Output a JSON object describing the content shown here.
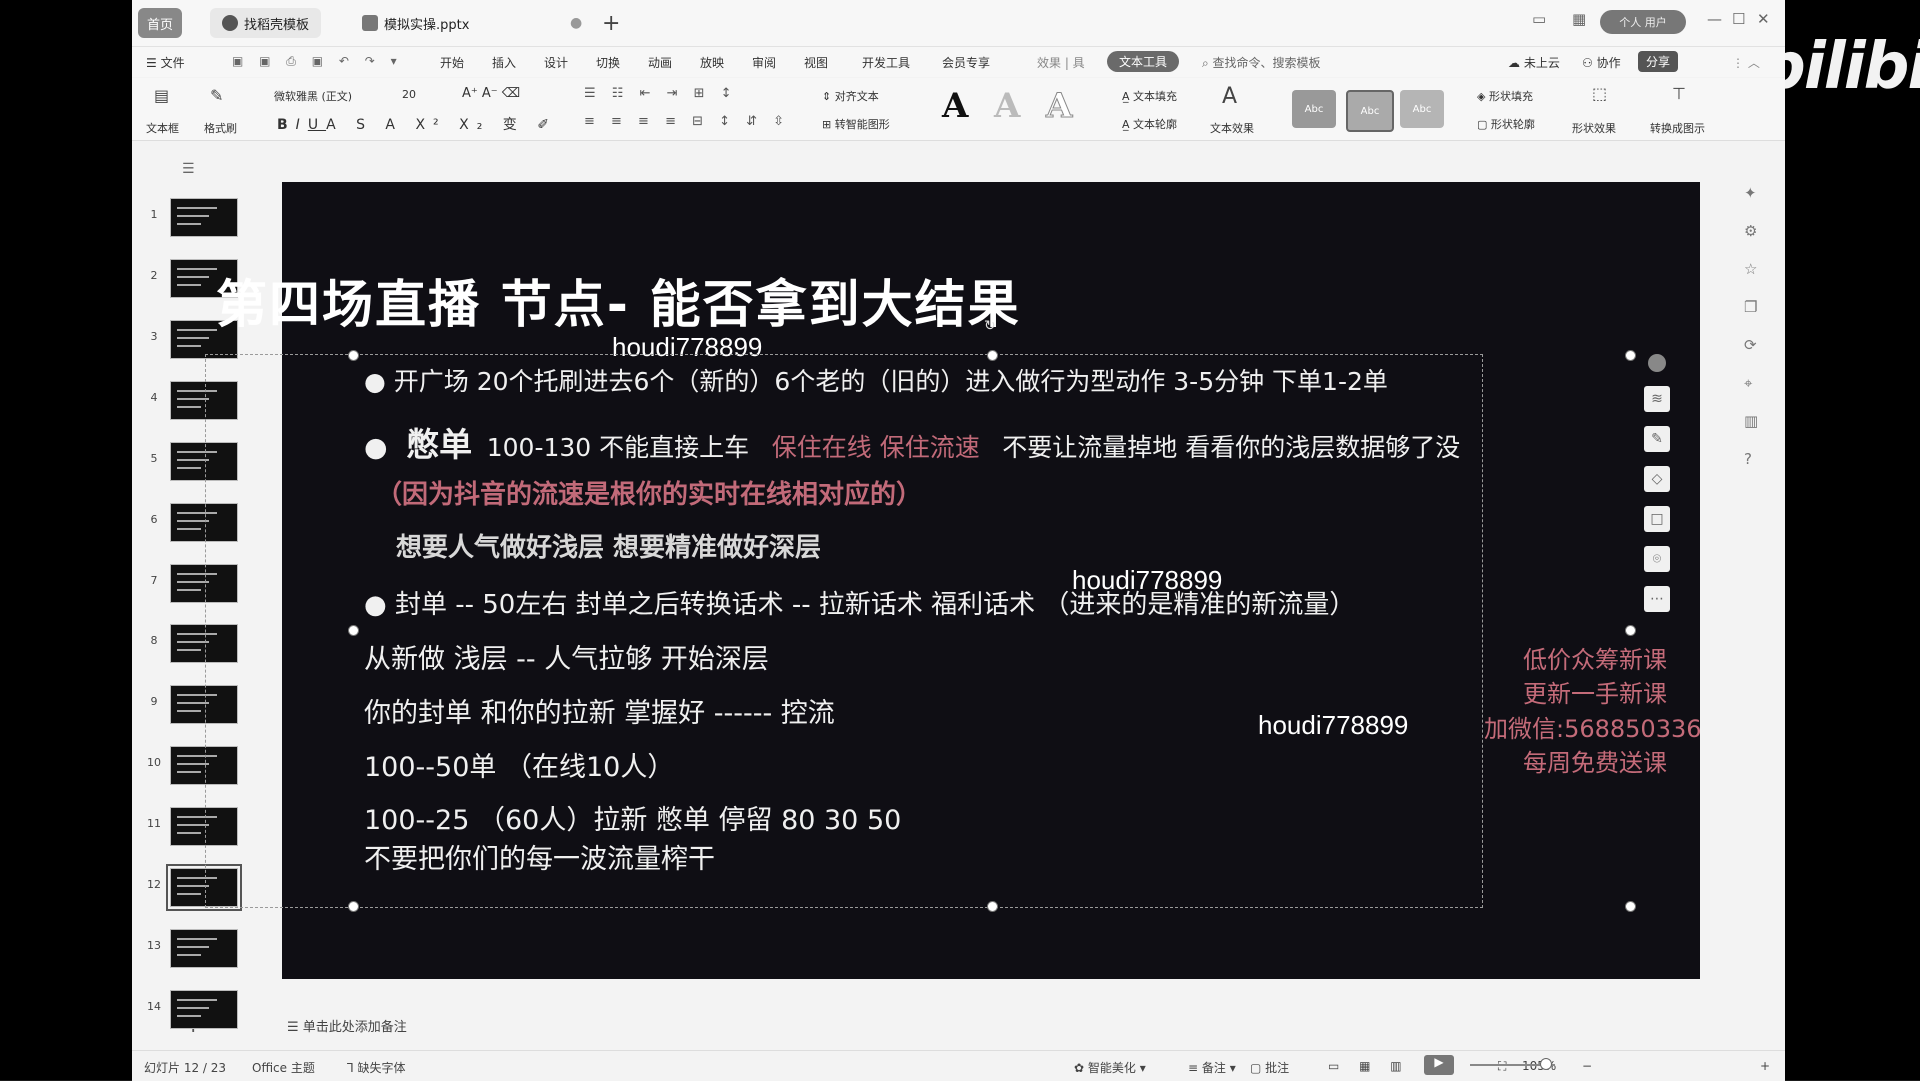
{
  "watermark_brand": "bilibili",
  "window": {
    "tabs": [
      {
        "label": "首页"
      },
      {
        "label": "找稻壳模板"
      },
      {
        "label": "模拟实操.pptx"
      }
    ],
    "user_name": "个人 用户"
  },
  "menu": {
    "file": "文件",
    "items": [
      "开始",
      "插入",
      "设计",
      "切换",
      "动画",
      "放映",
      "审阅",
      "视图",
      "开发工具",
      "会员专享"
    ],
    "extra": "效果 | 具",
    "active": "文本工具",
    "search": "查找命令、搜索模板",
    "cloud": "未上云",
    "share": "协作",
    "share_btn": "分享"
  },
  "ribbon": {
    "textbox": "文本框",
    "format_painter": "格式刷",
    "font_name": "微软雅黑 (正文)",
    "font_size": "20",
    "align_text": "对齐文本",
    "smart_shape": "转智能图形",
    "text_fill": "文本填充",
    "text_outline": "文本轮廓",
    "text_effect": "文本效果",
    "style_label": "Abc",
    "shape_fill": "形状填充",
    "shape_outline": "形状轮廓",
    "shape_effect": "形状效果",
    "convert": "转换成图示"
  },
  "thumbnails": [
    "1",
    "2",
    "3",
    "4",
    "5",
    "6",
    "7",
    "8",
    "9",
    "10",
    "11",
    "12",
    "13",
    "14"
  ],
  "selected_slide": 12,
  "slide": {
    "title": "第四场直播   节点- 能否拿到大结果",
    "watermark": "houdi778899",
    "lines": {
      "l1": "● 开广场 20个托刷进去6个（新的）6个老的（旧的）进入做行为型动作 3-5分钟 下单1-2单",
      "l2_bullet": "●",
      "l2_big": "憋单",
      "l2_rest": "100-130  不能直接上车",
      "l2_pink": "保住在线  保住流速",
      "l2_tail": "不要让流量掉地  看看你的浅层数据够了没",
      "l3": "（因为抖音的流速是根你的实时在线相对应的）",
      "l4": "想要人气做好浅层  想要精准做好深层",
      "l5": "● 封单 -- 50左右  封单之后转换话术 -- 拉新话术  福利话术  （进来的是精准的新流量）",
      "l6": "从新做  浅层   --   人气拉够  开始深层",
      "l7": "你的封单  和你的拉新  掌握好  ------  控流",
      "l8": "100--50单     （在线10人）",
      "l9": "100--25       （60人）拉新  憋单  停留  80  30  50",
      "l10": "不要把你们的每一波流量榨干"
    },
    "promo": [
      "低价众筹新课",
      "更新一手新课",
      "加微信:568850336",
      "每周免费送课"
    ]
  },
  "notes_placeholder": "单击此处添加备注",
  "status": {
    "slide_counter": "幻灯片 12 / 23",
    "theme": "Office 主题",
    "missing_font": "缺失字体",
    "beautify": "智能美化",
    "notes": "备注",
    "comments": "批注",
    "zoom": "105%"
  }
}
